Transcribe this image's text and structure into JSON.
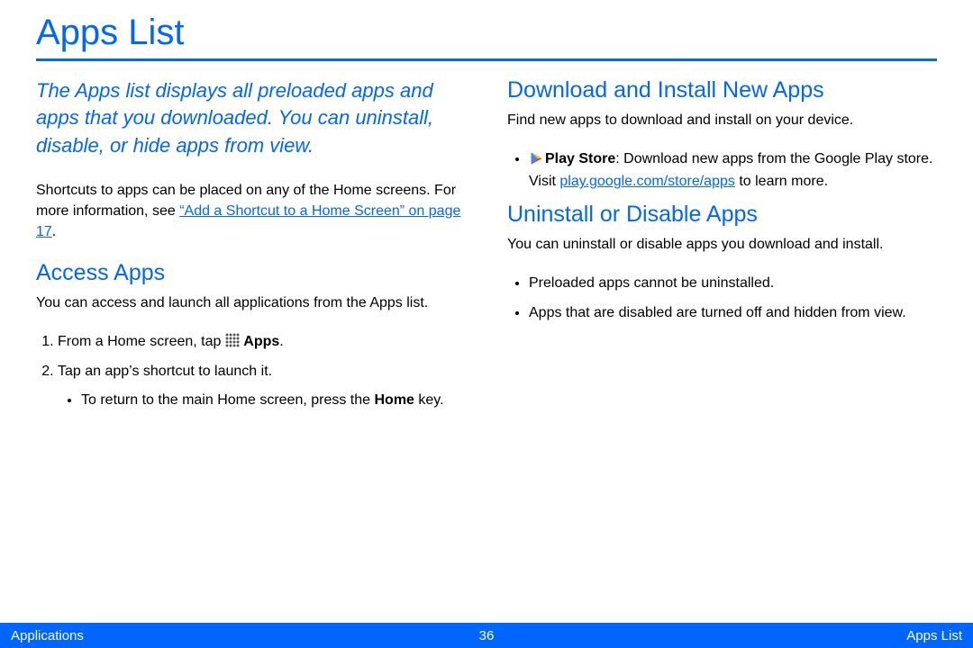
{
  "title": "Apps List",
  "left": {
    "intro": "The Apps list displays all preloaded apps and apps that you downloaded. You can uninstall, disable, or hide apps from view.",
    "shortcuts_pre": "Shortcuts to apps can be placed on any of the Home screens. For more information, see ",
    "shortcuts_link": "“Add a Shortcut to a Home Screen” on page 17",
    "shortcuts_post": ".",
    "access_heading": "Access Apps",
    "access_body": "You can access and launch all applications from the Apps list.",
    "step1_pre": "From a Home screen, tap ",
    "step1_bold": "Apps",
    "step1_post": ".",
    "step2": "Tap an app’s shortcut to launch it.",
    "step2_sub_pre": "To return to the main Home screen, press the ",
    "step2_sub_bold": "Home",
    "step2_sub_post": " key."
  },
  "right": {
    "download_heading": "Download and Install New Apps",
    "download_body": "Find new apps to download and install on your device.",
    "play_bold": "Play Store",
    "play_mid": ": Download new apps from the Google Play store. Visit ",
    "play_link": "play.google.com/store/apps",
    "play_post": " to learn more.",
    "uninstall_heading": "Uninstall or Disable Apps",
    "uninstall_body": "You can uninstall or disable apps you download and install.",
    "uninstall_b1": "Preloaded apps cannot be uninstalled.",
    "uninstall_b2": "Apps that are disabled are turned off and hidden from view."
  },
  "footer": {
    "left": "Applications",
    "center": "36",
    "right": "Apps List"
  }
}
